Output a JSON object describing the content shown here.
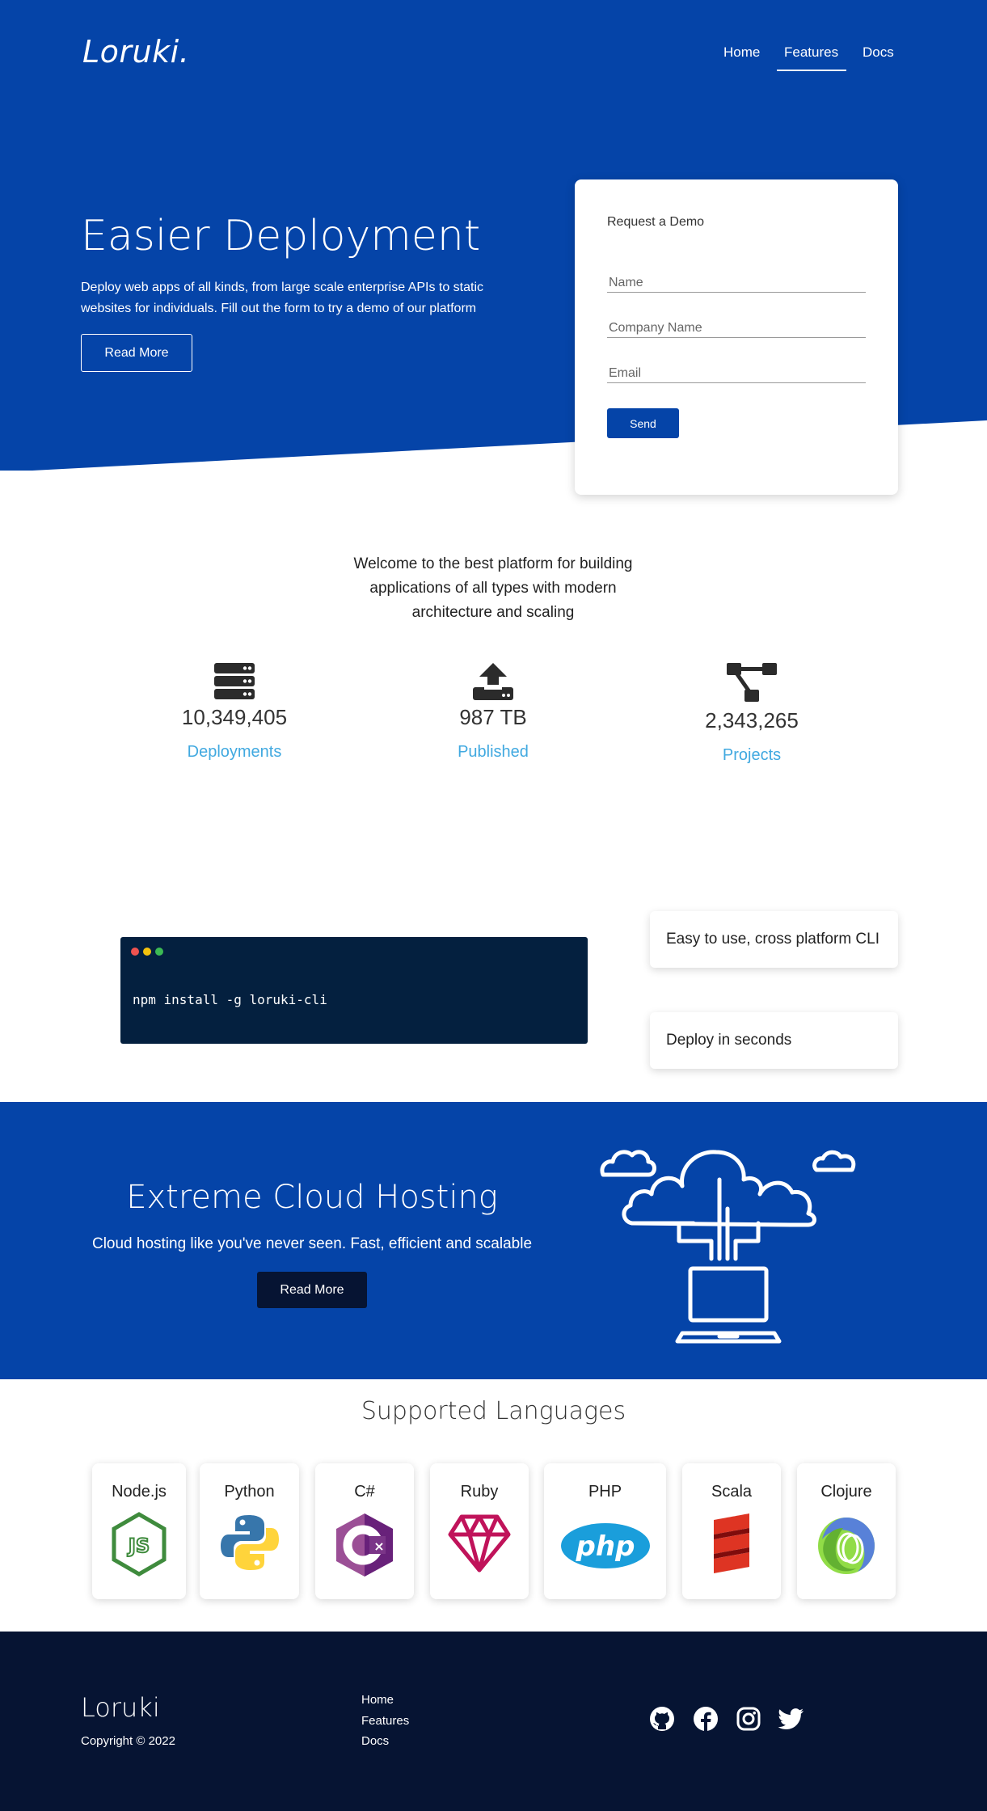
{
  "brand": "Loruki.",
  "nav": {
    "items": [
      "Home",
      "Features",
      "Docs"
    ],
    "active": "Features"
  },
  "hero": {
    "title": "Easier Deployment",
    "description": "Deploy web apps of all kinds, from large scale enterprise APIs to static websites for individuals. Fill out the form to try a demo of our platform",
    "button_label": "Read More"
  },
  "demo_form": {
    "title": "Request a Demo",
    "name_placeholder": "Name",
    "company_placeholder": "Company Name",
    "email_placeholder": "Email",
    "send_label": "Send"
  },
  "welcome": {
    "text": "Welcome to the best platform for building applications of all types with modern architecture and scaling"
  },
  "stats": [
    {
      "icon": "server-icon",
      "value": "10,349,405",
      "label": "Deployments"
    },
    {
      "icon": "upload-icon",
      "value": "987 TB",
      "label": "Published"
    },
    {
      "icon": "project-diagram-icon",
      "value": "2,343,265",
      "label": "Projects"
    }
  ],
  "cli": {
    "command": "npm install -g loruki-cli",
    "features": [
      "Easy to use, cross platform CLI",
      "Deploy in seconds"
    ]
  },
  "cloud": {
    "title": "Extreme Cloud Hosting",
    "description": "Cloud hosting like you've never seen. Fast, efficient and scalable",
    "button_label": "Read More"
  },
  "languages": {
    "title": "Supported Languages",
    "items": [
      "Node.js",
      "Python",
      "C#",
      "Ruby",
      "PHP",
      "Scala",
      "Clojure"
    ]
  },
  "footer": {
    "brand": "Loruki",
    "copyright": "Copyright © 2022",
    "links": [
      "Home",
      "Features",
      "Docs"
    ],
    "social": [
      "github-icon",
      "facebook-icon",
      "instagram-icon",
      "twitter-icon"
    ]
  },
  "colors": {
    "primary": "#0544a8",
    "dark": "#061433",
    "terminal": "#04203f",
    "stat_label": "#41a9e0"
  }
}
